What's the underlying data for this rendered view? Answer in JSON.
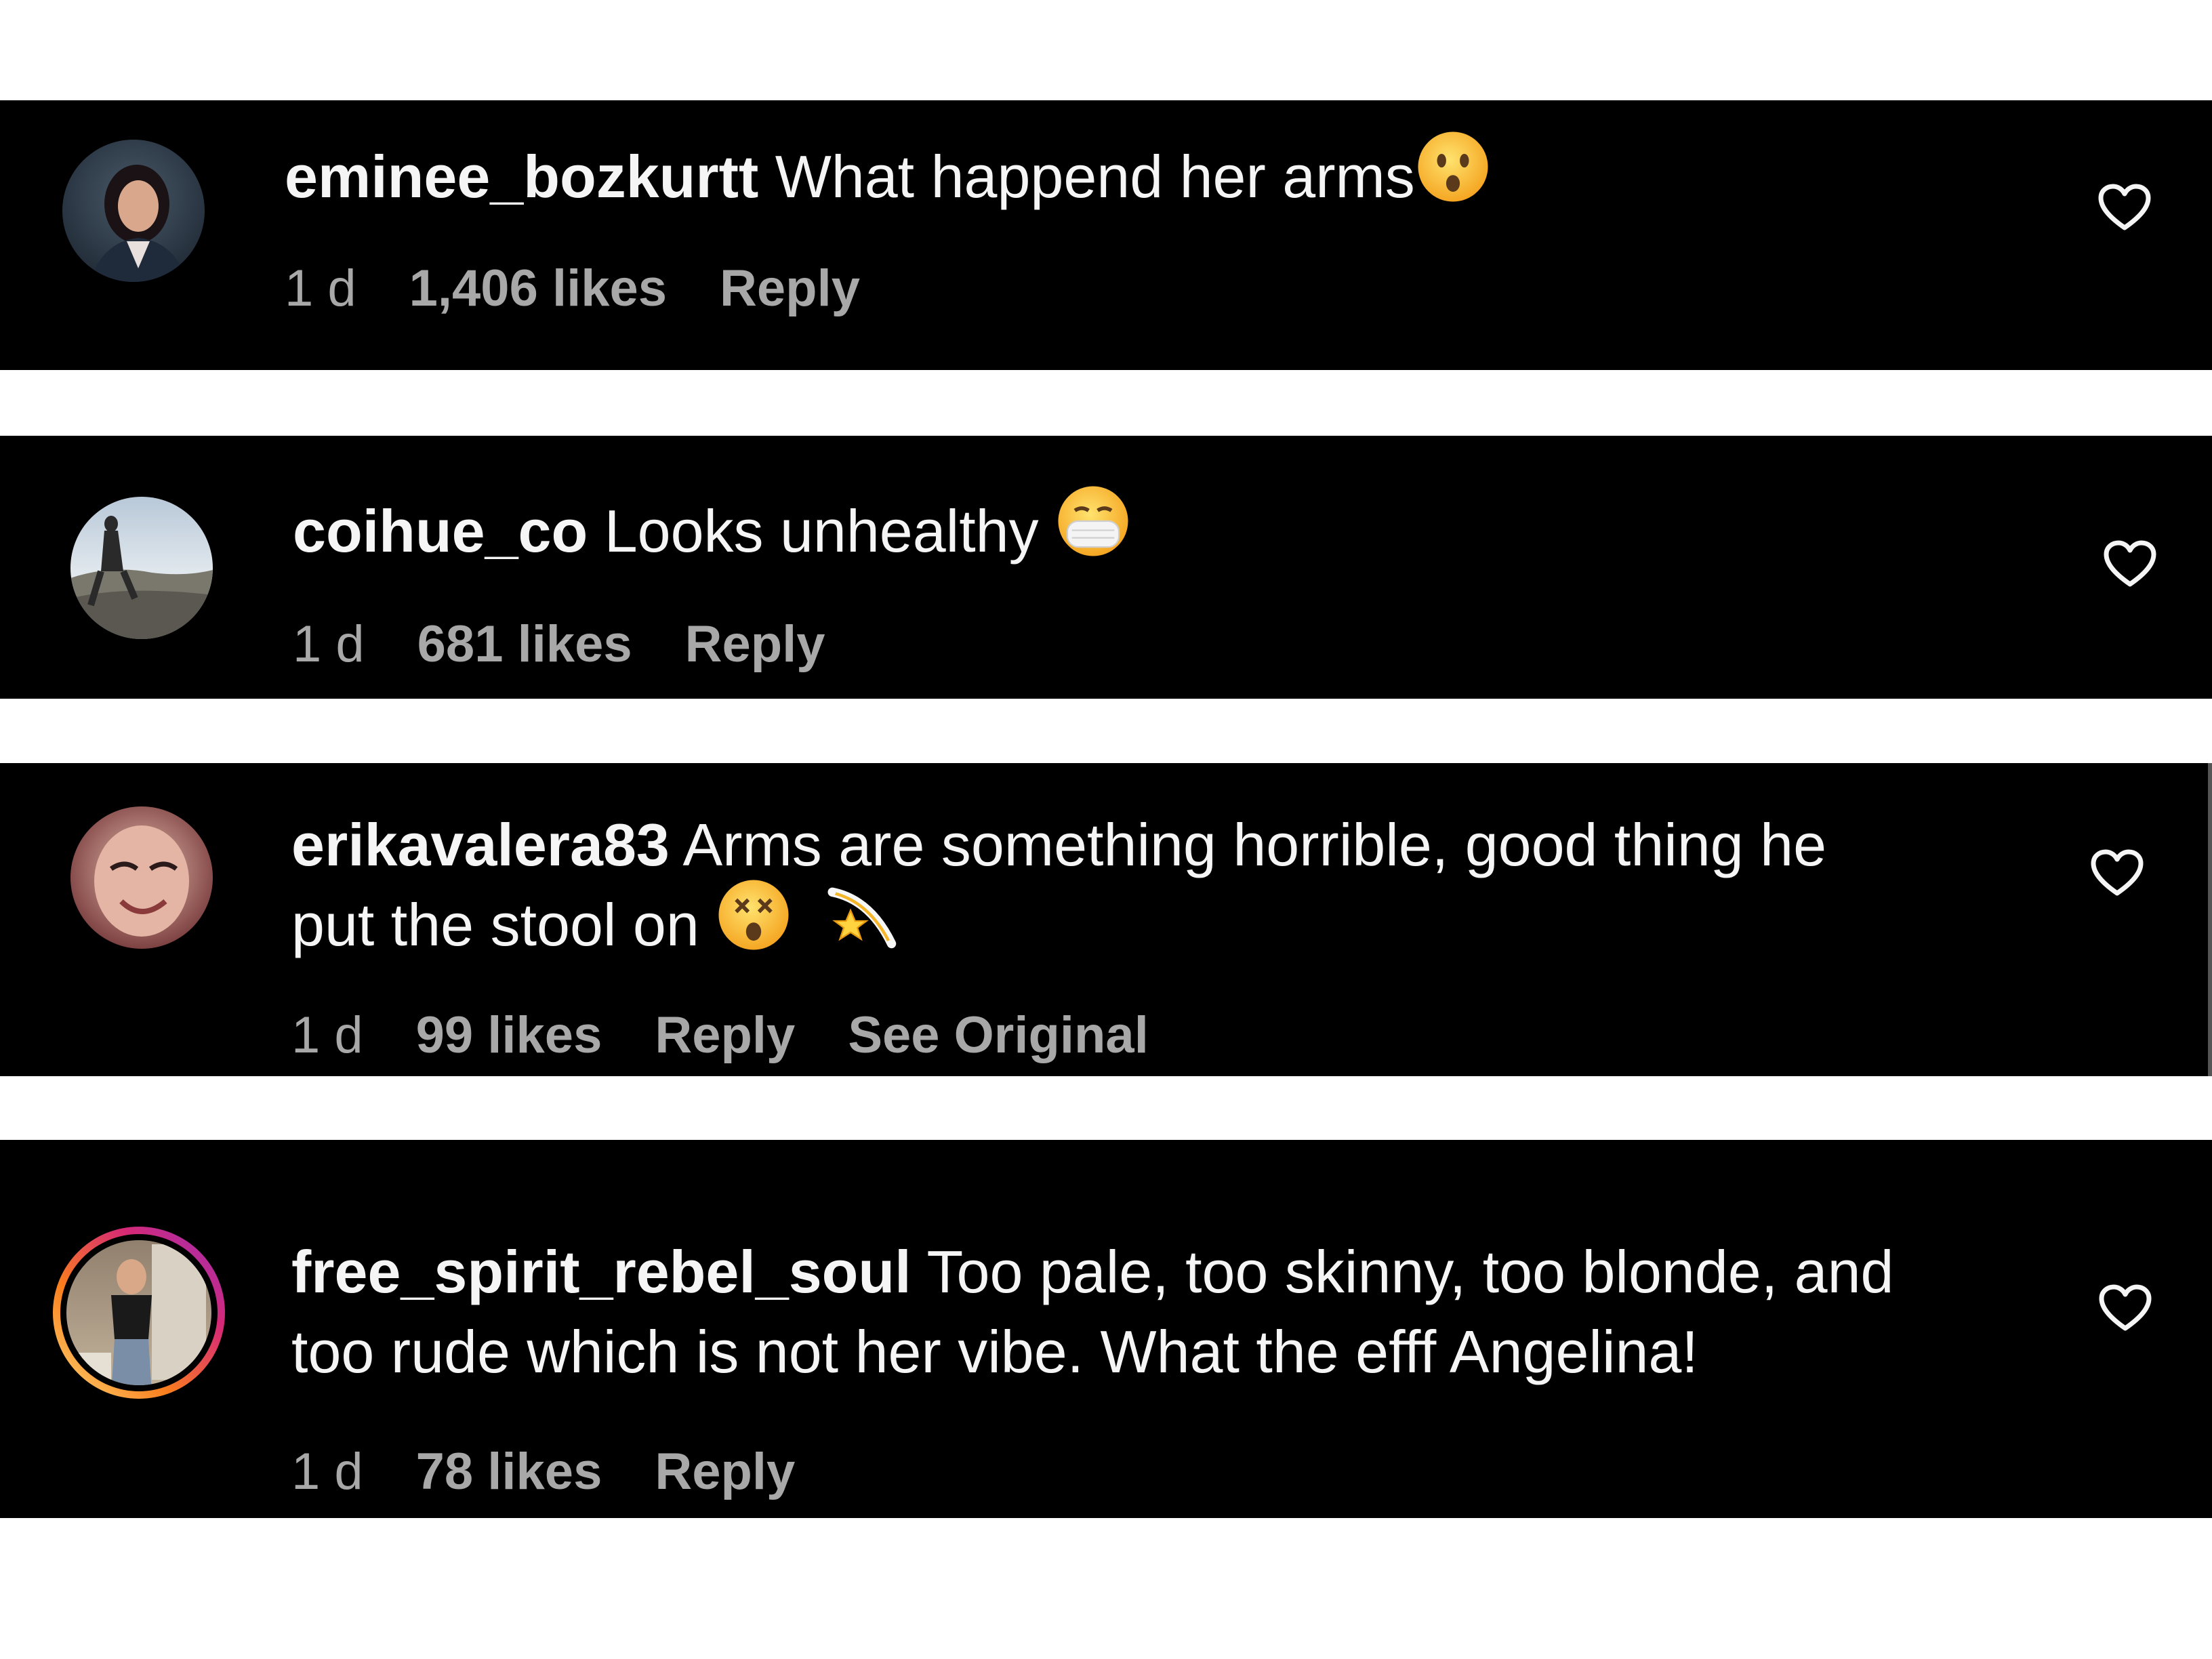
{
  "comments": [
    {
      "username": "eminee_bozkurtt",
      "text": "What happend her arms",
      "emoji_after": [
        "astonished-face-emoji"
      ],
      "time": "1 d",
      "likes": "1,406 likes",
      "reply": "Reply",
      "see_original": "",
      "icon": "heart-outline-icon",
      "avatar": "profile-photo-woman-dark-hair"
    },
    {
      "username": "coihue_co",
      "text": "Looks unhealthy",
      "emoji_after": [
        "face-with-medical-mask-emoji"
      ],
      "time": "1 d",
      "likes": "681 likes",
      "reply": "Reply",
      "see_original": "",
      "icon": "heart-outline-icon",
      "avatar": "profile-photo-person-on-mountain"
    },
    {
      "username": "erikavalera83",
      "text_line1": "Arms are something horrible, good thing he",
      "text_line2": "put the stool on",
      "emoji_after": [
        "dizzy-face-emoji",
        "dizzy-star-emoji"
      ],
      "time": "1 d",
      "likes": "99 likes",
      "reply": "Reply",
      "see_original": "See Original",
      "icon": "heart-outline-icon",
      "avatar": "profile-photo-woman-smiling"
    },
    {
      "username": "free_spirit_rebel_soul",
      "text_line1": "Too pale, too skinny, too blonde, and",
      "text_line2": "too rude which is not her vibe. What the efff Angelina!",
      "time": "1 d",
      "likes": "78 likes",
      "reply": "Reply",
      "see_original": "",
      "icon": "heart-outline-icon",
      "avatar": "profile-photo-mirror-selfie-story-ring"
    }
  ],
  "colors": {
    "card_background": "#000000",
    "page_background": "#ffffff",
    "text_primary": "#f5f5f5",
    "text_secondary": "#a8a8a8",
    "story_ring_gradient": [
      "#feda75",
      "#fa7e1e",
      "#d62976",
      "#962fbf"
    ]
  }
}
